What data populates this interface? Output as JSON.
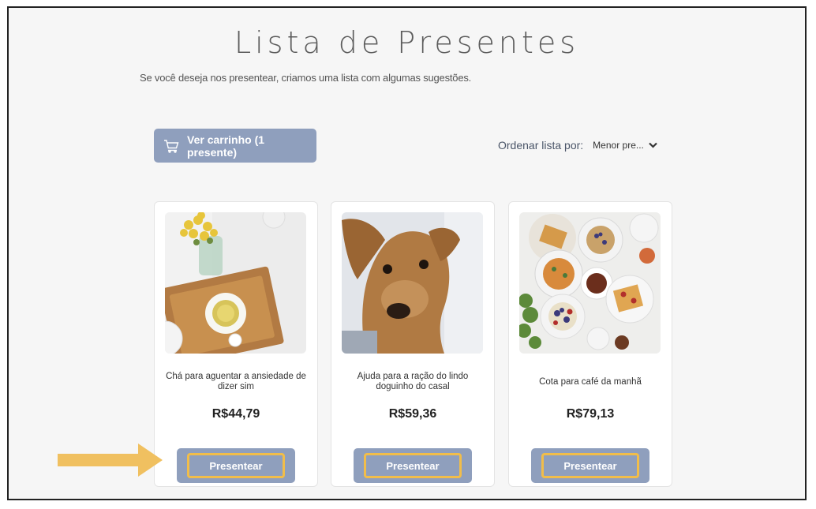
{
  "page": {
    "title": "Lista de Presentes",
    "subtitle": "Se você deseja nos presentear, criamos uma lista com algumas sugestões."
  },
  "cart": {
    "label": "Ver carrinho (1 presente)",
    "icon": "cart-icon"
  },
  "sort": {
    "label": "Ordenar lista por:",
    "selected": "Menor pre...",
    "icon": "chevron-down-icon"
  },
  "products": [
    {
      "name": "Chá para aguentar a ansiedade de dizer sim",
      "price": "R$44,79",
      "button": "Presentear",
      "image": "tea-tray-flowers-photo"
    },
    {
      "name": "Ajuda para a ração do lindo doguinho do casal",
      "price": "R$59,36",
      "button": "Presentear",
      "image": "dog-photo"
    },
    {
      "name": "Cota para café da manhã",
      "price": "R$79,13",
      "button": "Presentear",
      "image": "breakfast-table-photo"
    }
  ],
  "colors": {
    "button": "#8f9fbd",
    "highlight": "#f1bd4a",
    "arrow": "#f0c060"
  }
}
